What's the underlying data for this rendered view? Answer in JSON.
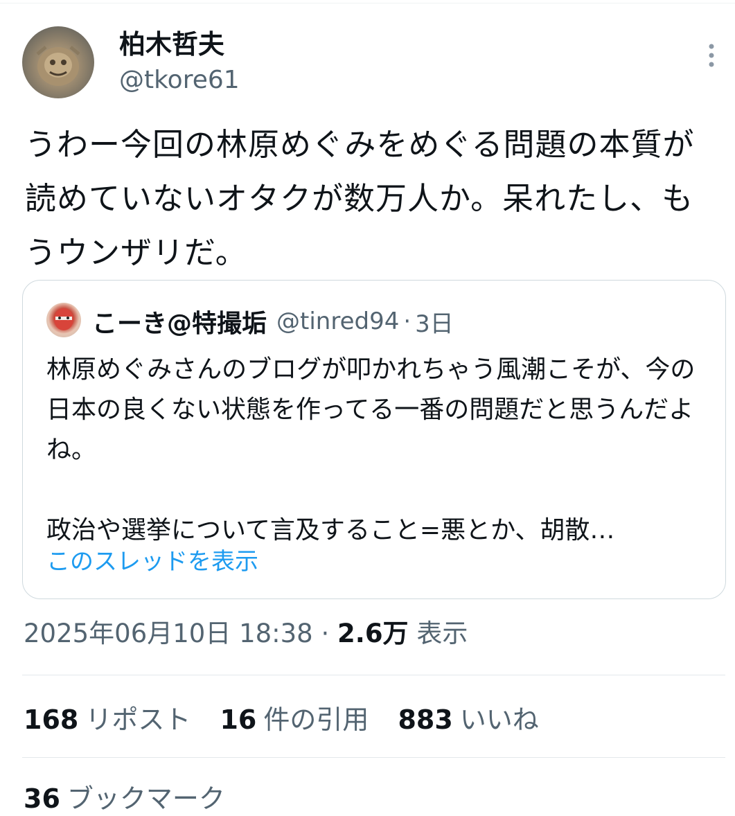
{
  "author": {
    "name": "柏木哲夫",
    "handle": "@tkore61"
  },
  "tweet": {
    "text": "うわー今回の林原めぐみをめぐる問題の本質が読めていないオタクが数万人か。呆れたし、もうウンザリだ。"
  },
  "quote": {
    "name": "こーき@特撮垢",
    "handle": "@tinred94",
    "separator": "·",
    "time": "3日",
    "text": "林原めぐみさんのブログが叩かれちゃう風潮こそが、今の日本の良くない状態を作ってる一番の問題だと思うんだよね。\n\n政治や選挙について言及すること=悪とか、胡散…",
    "show_thread": "このスレッドを表示"
  },
  "meta": {
    "timestamp": "2025年06月10日 18:38",
    "separator": "·",
    "views_count": "2.6万",
    "views_label": "表示"
  },
  "stats": {
    "reposts_count": "168",
    "reposts_label": "リポスト",
    "quotes_count": "16",
    "quotes_label": "件の引用",
    "likes_count": "883",
    "likes_label": "いいね",
    "bookmarks_count": "36",
    "bookmarks_label": "ブックマーク"
  },
  "colors": {
    "text_primary": "#0f1419",
    "text_secondary": "#536471",
    "link": "#1d9bf0",
    "border": "#cfd9de"
  },
  "icons": {
    "more": "more-vertical-icon"
  }
}
